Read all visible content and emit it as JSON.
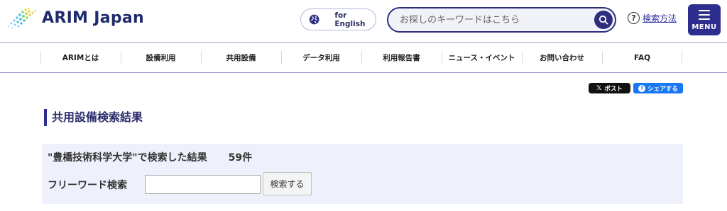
{
  "header": {
    "logo_text": "ARIM Japan",
    "lang_button_label": "for English",
    "search_placeholder": "お探しのキーワードはこちら",
    "help_label": "検索方法",
    "menu_label": "MENU"
  },
  "nav": {
    "items": [
      "ARIMとは",
      "設備利用",
      "共用設備",
      "データ利用",
      "利用報告書",
      "ニュース・イベント",
      "お問い合わせ",
      "FAQ"
    ]
  },
  "share": {
    "x_label": "ポスト",
    "fb_label": "シェアする"
  },
  "page": {
    "title": "共用設備検索結果"
  },
  "results": {
    "query_text": "\"豊橋技術科学大学\"で検索した結果",
    "count_text": "59件",
    "freeword_label": "フリーワード検索",
    "freeword_value": "",
    "submit_label": "検索する"
  },
  "colors": {
    "brand_navy": "#2e2e8e",
    "results_bg": "#eef1fb",
    "facebook_blue": "#1877f2"
  }
}
